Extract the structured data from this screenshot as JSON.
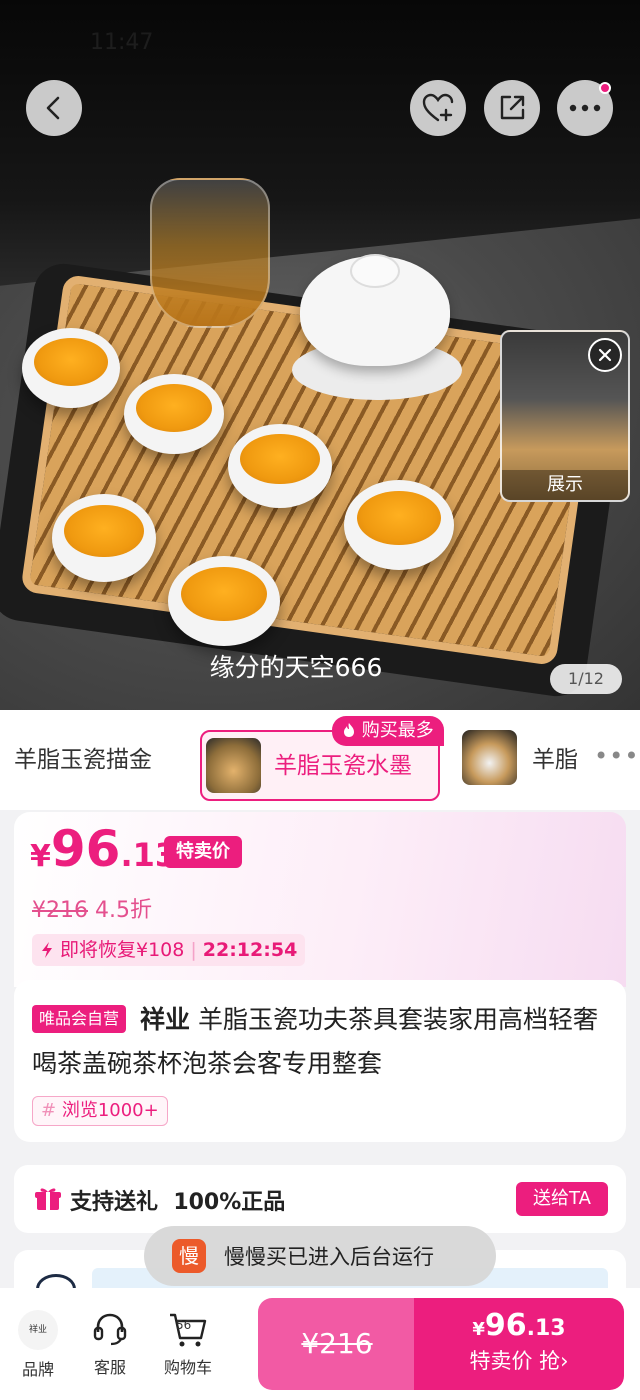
{
  "status_bar": {
    "time": "11:47"
  },
  "hero": {
    "caption": "缘分的天空666",
    "image_counter": "1/12",
    "preview_label": "展示"
  },
  "variants": {
    "items": [
      {
        "label": "羊脂玉瓷描金"
      },
      {
        "label": "羊脂玉瓷水墨",
        "badge": "购买最多",
        "selected": true
      },
      {
        "label": "羊脂"
      }
    ]
  },
  "price": {
    "currency": "¥",
    "int": "96",
    "dec": ".13",
    "special_label": "特卖价",
    "original": "¥216",
    "discount": "4.5折",
    "restore_text": "即将恢复¥108",
    "countdown": "22:12:54"
  },
  "product": {
    "vip_badge": "唯品会自营",
    "brand": "祥业",
    "title": "羊脂玉瓷功夫茶具套装家用高档轻奢喝茶盖碗茶杯泡茶会客专用整套",
    "browse": "浏览1000+"
  },
  "gift": {
    "text": "支持送礼  100%正品",
    "button": "送给TA"
  },
  "toast": {
    "logo": "慢",
    "text": "慢慢买已进入后台运行"
  },
  "bottom": {
    "brand_label": "品牌",
    "brand_logo_text": "祥业",
    "service_label": "客服",
    "cart_label": "购物车",
    "cart_count": "56",
    "orig_price": "¥216",
    "buy_currency": "¥",
    "buy_int": "96",
    "buy_dec": ".13",
    "buy_label": "特卖价 抢"
  },
  "colors": {
    "accent": "#ec1e7e",
    "accent_light": "#f25aa4"
  }
}
